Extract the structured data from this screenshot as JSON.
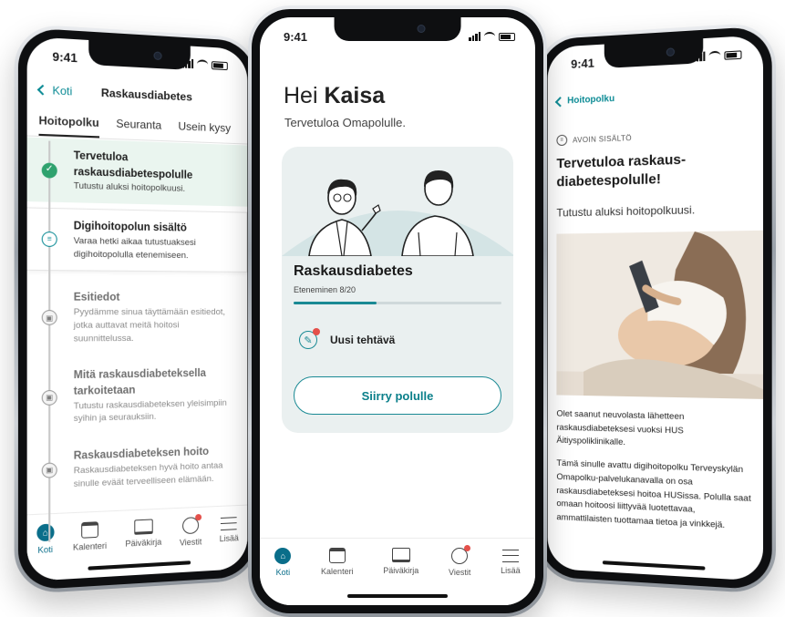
{
  "colors": {
    "accent": "#1a8a94",
    "success": "#2fa26e",
    "notification": "#e4504a",
    "card_bg": "#eaf0f0"
  },
  "left_phone": {
    "status_time": "9:41",
    "back_label": "Koti",
    "title": "Raskausdiabetes",
    "tabs": [
      "Hoitopolku",
      "Seuranta",
      "Usein kysy"
    ],
    "steps": [
      {
        "title": "Tervetuloa raskausdiabetespolulle",
        "desc": "Tutustu aluksi hoitopolkuusi.",
        "state": "done",
        "icon": "check-icon"
      },
      {
        "title": "Digihoitopolun sisältö",
        "desc": "Varaa hetki aikaa tutustuaksesi digihoitopolulla etenemiseen.",
        "state": "current",
        "icon": "document-icon"
      },
      {
        "title": "Esitiedot",
        "desc": "Pyydämme sinua täyttämään esitiedot, jotka auttavat meitä hoitosi suunnittelussa.",
        "state": "locked",
        "icon": "lock-icon"
      },
      {
        "title": "Mitä raskausdiabeteksella tarkoitetaan",
        "desc": "Tutustu raskausdiabeteksen yleisimpiin syihin ja seurauksiin.",
        "state": "locked",
        "icon": "lock-icon"
      },
      {
        "title": "Raskausdiabeteksen hoito",
        "desc": "Raskausdiabeteksen hyvä hoito antaa sinulle eväät terveelliseen elämään.",
        "state": "locked",
        "icon": "lock-icon"
      }
    ],
    "tabbar": [
      "Koti",
      "Kalenteri",
      "Päiväkirja",
      "Viestit",
      "Lisää"
    ]
  },
  "center_phone": {
    "status_time": "9:41",
    "greeting_prefix": "Hei ",
    "greeting_name": "Kaisa",
    "subtitle": "Tervetuloa Omapolulle.",
    "card": {
      "title": "Raskausdiabetes",
      "progress_label": "Eteneminen 8/20",
      "progress": 0.4,
      "task_label": "Uusi tehtävä",
      "button_label": "Siirry polulle"
    },
    "tabbar": [
      "Koti",
      "Kalenteri",
      "Päiväkirja",
      "Viestit",
      "Lisää"
    ]
  },
  "right_phone": {
    "status_time": "9:41",
    "back_label": "Hoitopolku",
    "content_tag": "AVOIN SISÄLTÖ",
    "title": "Tervetuloa raskaus-diabetespolulle!",
    "lead": "Tutustu aluksi hoitopolkuusi.",
    "body": [
      "Olet saanut neuvolasta lähetteen raskausdiabeteksesi vuoksi HUS Äitiyspoliklinikalle.",
      "Tämä sinulle avattu digihoitopolku Terveyskylän Omapolku-palvelukanavalla on osa raskausdiabeteksesi hoitoa HUSissa. Polulla saat omaan hoitoosi liittyvää luotettavaa, ammattilaisten tuottamaa tietoa ja vinkkejä."
    ]
  }
}
